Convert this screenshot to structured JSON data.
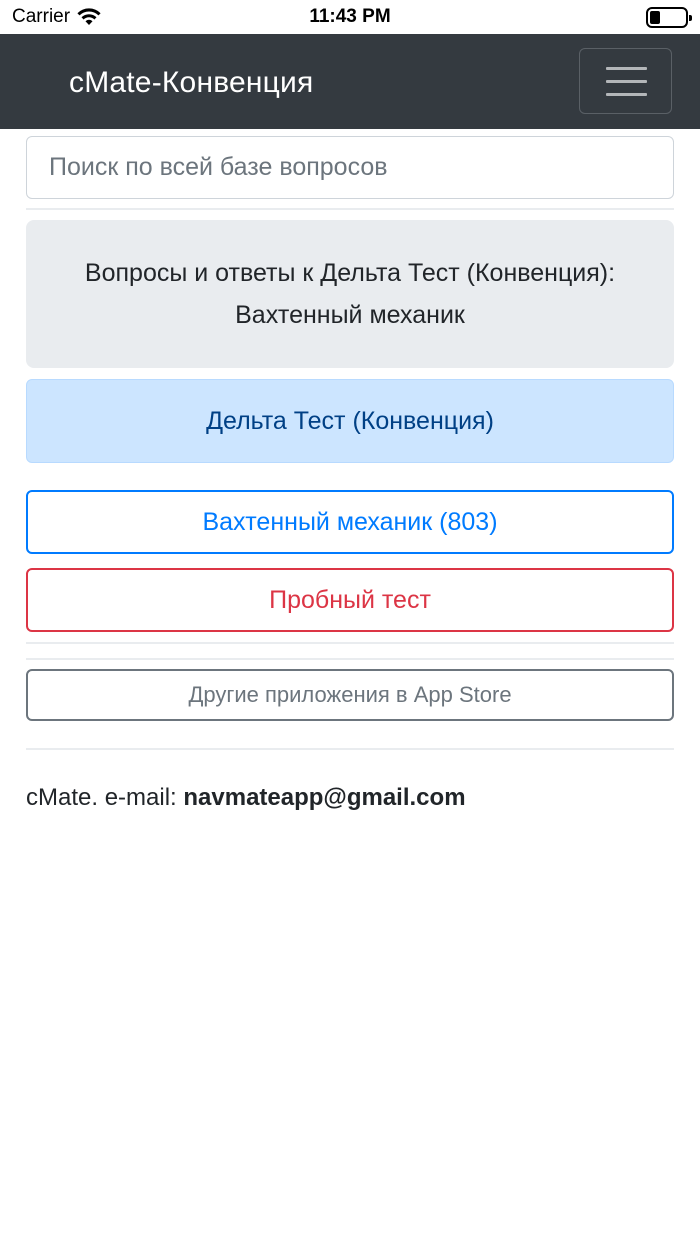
{
  "status_bar": {
    "carrier": "Carrier",
    "time": "11:43 PM",
    "battery_level": 0.3
  },
  "navbar": {
    "brand": "cMate-Конвенция",
    "menu_icon": "hamburger-menu-icon"
  },
  "search": {
    "placeholder": "Поиск по всей базе вопросов",
    "value": ""
  },
  "header_box": {
    "line1": "Вопросы и ответы к Дельта Тест (Конвенция):",
    "line2": "Вахтенный механик"
  },
  "section": {
    "title": "Дельта Тест (Конвенция)"
  },
  "buttons": {
    "category": "Вахтенный механик (803)",
    "trial_test": "Пробный тест",
    "other_apps": "Другие приложения в App Store"
  },
  "footer": {
    "prefix": "cMate. e-mail:",
    "email": "navmateapp@gmail.com"
  },
  "colors": {
    "navbar_bg": "#343a40",
    "primary": "#007bff",
    "danger": "#dc3545",
    "secondary": "#6c757d",
    "info_bg": "#cce5ff",
    "info_text": "#004085"
  }
}
